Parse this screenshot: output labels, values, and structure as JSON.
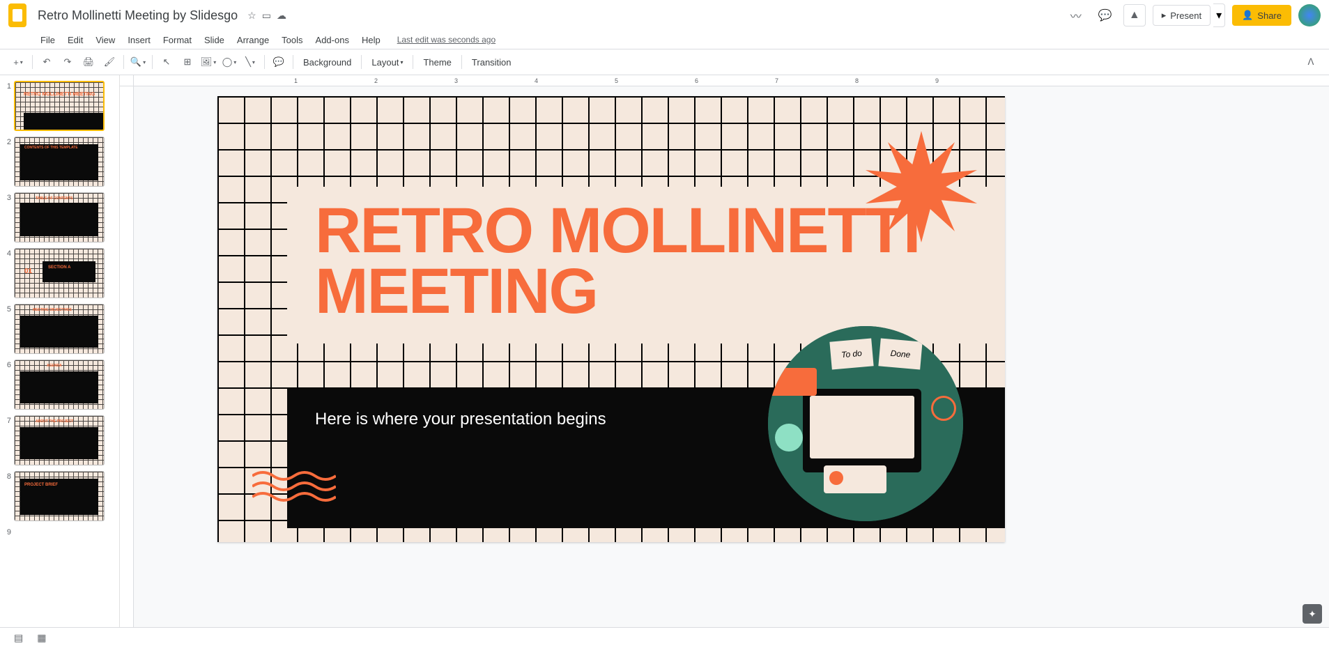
{
  "header": {
    "doc_title": "Retro Mollinetti Meeting by Slidesgo",
    "present": "Present",
    "share": "Share",
    "last_edit": "Last edit was seconds ago"
  },
  "menu": {
    "file": "File",
    "edit": "Edit",
    "view": "View",
    "insert": "Insert",
    "format": "Format",
    "slide": "Slide",
    "arrange": "Arrange",
    "tools": "Tools",
    "addons": "Add-ons",
    "help": "Help"
  },
  "toolbar": {
    "background": "Background",
    "layout": "Layout",
    "theme": "Theme",
    "transition": "Transition"
  },
  "slide": {
    "title": "RETRO MOLLINETTI MEETING",
    "subtitle": "Here is where your presentation begins",
    "sticky_todo": "To do",
    "sticky_done": "Done"
  },
  "thumbs": [
    {
      "n": "1",
      "t": "RETRO MOLLINETTI MEETING"
    },
    {
      "n": "2",
      "t": "CONTENTS OF THIS TEMPLATE"
    },
    {
      "n": "3",
      "t": "TABLE OF CONTENTS"
    },
    {
      "n": "4",
      "t": "01 SECTION A"
    },
    {
      "n": "5",
      "t": "MEETING OBJECTIVES"
    },
    {
      "n": "6",
      "t": "AGENDA"
    },
    {
      "n": "7",
      "t": "ABOUT THE PROJECT"
    },
    {
      "n": "8",
      "t": "PROJECT BRIEF"
    },
    {
      "n": "9",
      "t": ""
    }
  ],
  "ruler_marks": [
    "1",
    "2",
    "3",
    "4",
    "5",
    "6",
    "7",
    "8",
    "9"
  ],
  "colors": {
    "accent": "#f76c3c",
    "bg": "#f5e8dd",
    "dark": "#0a0a0a",
    "share": "#fbbc04"
  }
}
